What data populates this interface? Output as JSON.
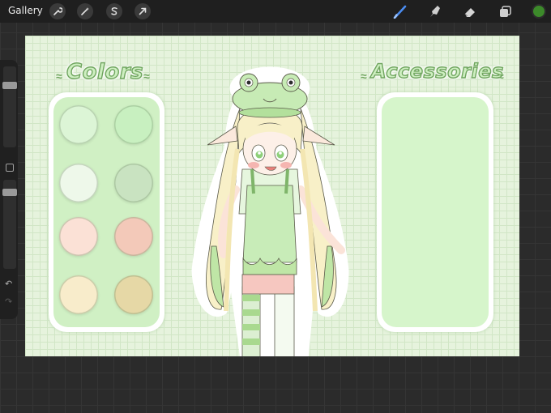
{
  "toolbar": {
    "gallery_label": "Gallery",
    "left_tools": [
      "wrench-icon",
      "magic-wand-icon",
      "selection-s-icon",
      "transform-arrow-icon"
    ],
    "right_tools": [
      "brush-icon",
      "smudge-icon",
      "eraser-icon",
      "layers-icon"
    ],
    "active_color": "#3c8a2a"
  },
  "canvas": {
    "colors_title": "Colors",
    "accessories_title": "Accessories",
    "swatches": [
      "#dcf5d6",
      "#c8f0c0",
      "#eef8ea",
      "#c9e3c1",
      "#fbe1d6",
      "#f3c9b9",
      "#f8eccb",
      "#e6d8a6"
    ],
    "colors_panel_fill": "#d0f0c4",
    "accessories_panel_fill": "#d6f5cb"
  }
}
